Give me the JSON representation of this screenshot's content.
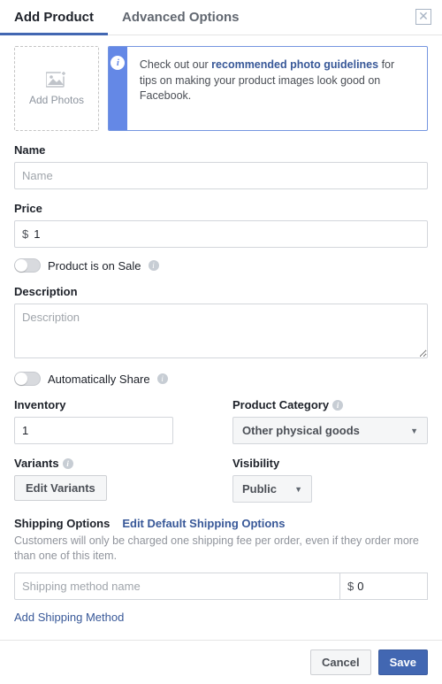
{
  "tabs": {
    "add_product": "Add Product",
    "advanced": "Advanced Options"
  },
  "photo_drop": {
    "label": "Add Photos"
  },
  "info": {
    "prefix": "Check out our ",
    "link": "recommended photo guidelines",
    "suffix": " for tips on making your product images look good on Facebook."
  },
  "name": {
    "label": "Name",
    "placeholder": "Name",
    "value": ""
  },
  "price": {
    "label": "Price",
    "currency": "$",
    "value": "1"
  },
  "sale_toggle": {
    "label": "Product is on Sale",
    "on": false
  },
  "description": {
    "label": "Description",
    "placeholder": "Description",
    "value": ""
  },
  "auto_share": {
    "label": "Automatically Share",
    "on": false
  },
  "inventory": {
    "label": "Inventory",
    "value": "1"
  },
  "category": {
    "label": "Product Category",
    "selected": "Other physical goods"
  },
  "variants": {
    "label": "Variants",
    "button": "Edit Variants"
  },
  "visibility": {
    "label": "Visibility",
    "selected": "Public"
  },
  "shipping": {
    "title": "Shipping Options",
    "edit_link": "Edit Default Shipping Options",
    "desc": "Customers will only be charged one shipping fee per order, even if they order more than one of this item.",
    "method_placeholder": "Shipping method name",
    "method_value": "",
    "price_currency": "$",
    "price_value": "0",
    "add_link": "Add Shipping Method"
  },
  "footer": {
    "cancel": "Cancel",
    "save": "Save"
  }
}
